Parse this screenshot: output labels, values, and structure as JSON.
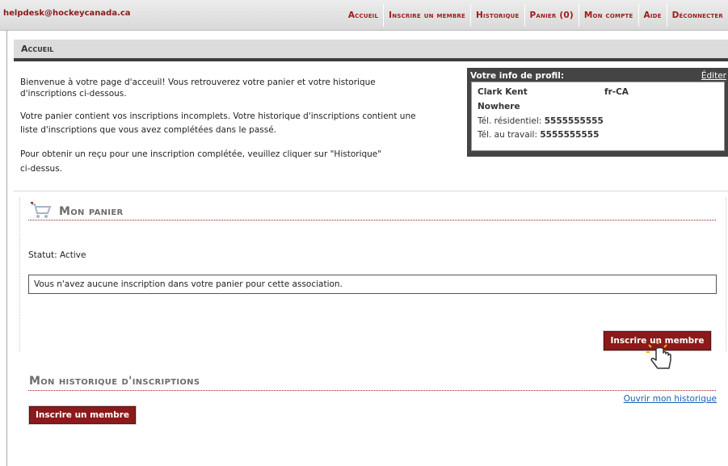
{
  "header": {
    "email": "helpdesk@hockeycanada.ca",
    "nav": [
      {
        "label": "Accueil"
      },
      {
        "label": "Inscrire un membre"
      },
      {
        "label": "Historique"
      },
      {
        "label": "Panier (0)"
      },
      {
        "label": "Mon compte"
      },
      {
        "label": "Aide"
      },
      {
        "label": "Déconnecter"
      }
    ]
  },
  "section": {
    "title": "Accueil"
  },
  "welcome": {
    "p1_line1": "Bienvenue à votre page d'acceuil! Vous retrouverez votre panier et votre historique",
    "p1_line2": "d'inscriptions ci-dessous.",
    "p2_line1": "Votre panier contient vos inscriptions incomplets. Votre historique d'inscriptions contient une",
    "p2_line2": "liste d'inscriptions que vous avez complétées dans le passé.",
    "p3_line1": "Pour obtenir un reçu pour une inscription complétée, veuillez cliquer sur \"Historique\"",
    "p3_line2": "ci-dessus."
  },
  "profile": {
    "title": "Votre info de profil:",
    "edit_label": "Éditer",
    "name": "Clark  Kent",
    "locale": "fr-CA",
    "city": "Nowhere",
    "home_phone_label": "Tél. résidentiel:",
    "home_phone": "5555555555",
    "work_phone_label": "Tél. au travail:",
    "work_phone": "5555555555"
  },
  "cart": {
    "title": "Mon panier",
    "status": "Statut: Active",
    "empty_message": "Vous n'avez aucune inscription dans votre panier pour cette association.",
    "register_button": "Inscrire un membre"
  },
  "history": {
    "title": "Mon historique d'inscriptions",
    "open_link": "Ouvrir mon historique",
    "register_button": "Inscrire un membre"
  },
  "colors": {
    "accent": "#8b1a1a",
    "nav_text": "#a01c1c",
    "profile_bg": "#444444",
    "link": "#1a5fb4"
  }
}
